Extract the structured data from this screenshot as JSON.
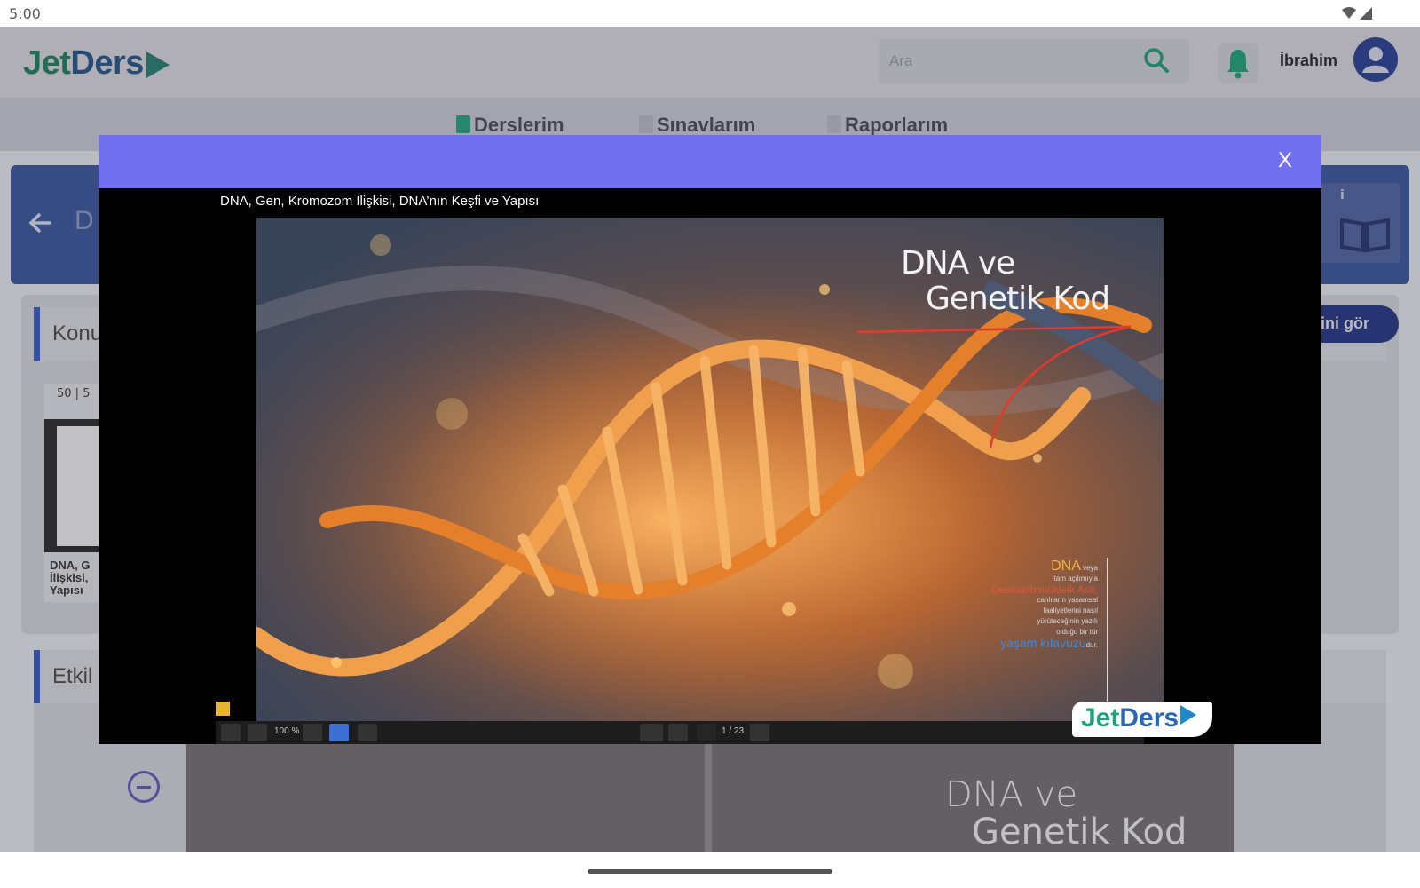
{
  "status_bar": {
    "time": "5:00"
  },
  "app": {
    "logo_jet": "Jet",
    "logo_ders": "Ders",
    "brand_color": "#1d4f86"
  },
  "header": {
    "search_placeholder": "Ara",
    "username": "İbrahim"
  },
  "nav": {
    "tabs": [
      {
        "label": "Derslerim",
        "icon": "book-icon",
        "color": "#1aa37a"
      },
      {
        "label": "Sınavlarım",
        "icon": "document-icon",
        "color": "#a9aeb8"
      },
      {
        "label": "Raporlarım",
        "icon": "report-icon",
        "color": "#a9aeb8"
      }
    ]
  },
  "background_page": {
    "hero_partial": "D",
    "section_konu": "Konu",
    "see_button": "ini gör",
    "thumb_pages": "50 | 5",
    "thumb_caption_line1": "DNA, G",
    "thumb_caption_line2": "İlişkisi,",
    "thumb_caption_line3": "Yapısı",
    "section_etkinlik": "Etkil",
    "viewer_title_line1": "DNA ve",
    "viewer_title_line2": "Genetik Kod"
  },
  "modal": {
    "close_label": "X",
    "header_color": "#7370ef",
    "doc_title": "DNA, Gen, Kromozom İlişkisi, DNA’nın Keşfi ve Yapısı",
    "slide": {
      "title_line1": "DNA ve",
      "title_line2": "Genetik Kod",
      "note_dna": "DNA",
      "note_veya": "veya",
      "note_line1": "tam açılımıyla",
      "note_deok": "Deoksiribonükleik Asit,",
      "note_line2": "canlıların yaşamsal",
      "note_line3": "faaliyetlerini nasıl",
      "note_line4": "yürüteceğinin yazılı",
      "note_line5": "olduğu bir tür",
      "note_yasam": "yaşam kılavuzu",
      "note_dur": "dur."
    },
    "toolbar": {
      "zoom": "100 %",
      "page_indicator": "1 / 23"
    },
    "badge_jet": "Jet",
    "badge_ders": "Ders"
  }
}
